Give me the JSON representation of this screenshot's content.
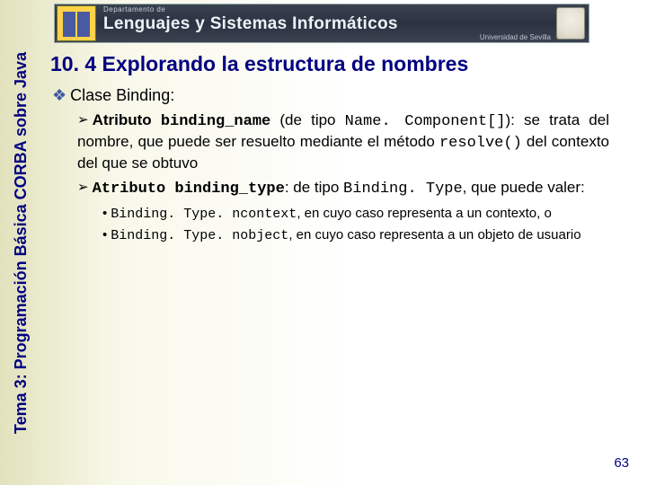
{
  "banner": {
    "dept": "Departamento de",
    "title": "Lenguajes y Sistemas Informáticos",
    "sub": "Universidad de Sevilla"
  },
  "side_label": "Tema 3: Programación Básica CORBA sobre Java",
  "heading": "10. 4 Explorando la estructura de nombres",
  "lvl1_text": "Clase Binding:",
  "attr1": {
    "lead_bold": "Atributo ",
    "lead_code": "binding_name",
    "mid1": " (de tipo ",
    "code2": "Name. Component[]",
    "mid2": "): se trata del nombre, que puede ser resuelto mediante el método ",
    "code3": "resolve()",
    "tail": " del contexto del que se obtuvo"
  },
  "attr2": {
    "lead_code": "Atributo binding_type",
    "mid1": ": de tipo ",
    "code2": "Binding. Type",
    "tail": ", que puede valer:"
  },
  "opt1": {
    "code": "Binding. Type. ncontext",
    "text": ", en cuyo caso representa a un contexto, o"
  },
  "opt2": {
    "code": "Binding. Type. nobject",
    "text": ", en cuyo caso representa a un objeto de usuario"
  },
  "page_number": "63"
}
